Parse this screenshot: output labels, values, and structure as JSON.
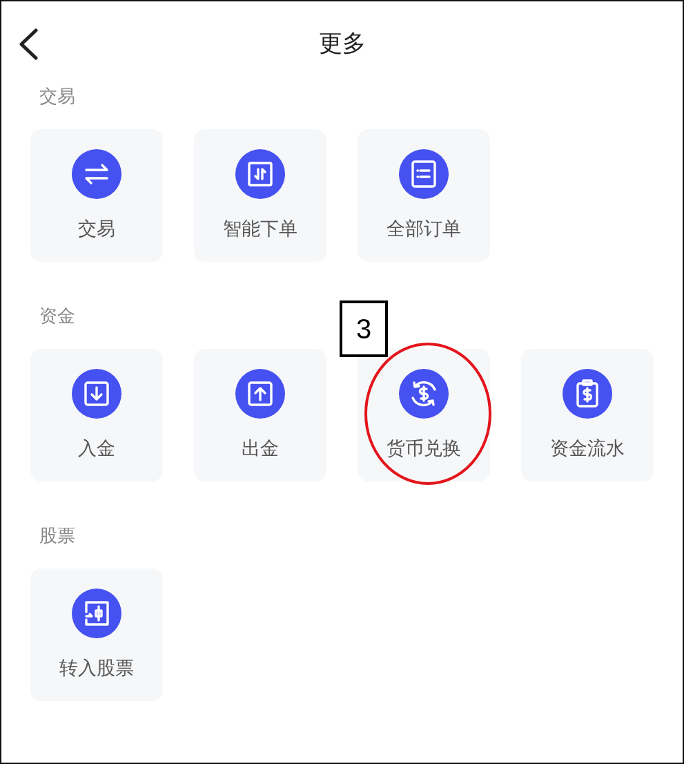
{
  "header": {
    "title": "更多"
  },
  "sections": [
    {
      "label": "交易",
      "items": [
        {
          "label": "交易",
          "kind": "swap",
          "circled": false
        },
        {
          "label": "智能下单",
          "kind": "updown",
          "circled": false
        },
        {
          "label": "全部订单",
          "kind": "list",
          "circled": false
        }
      ]
    },
    {
      "label": "资金",
      "items": [
        {
          "label": "入金",
          "kind": "deposit",
          "circled": false
        },
        {
          "label": "出金",
          "kind": "withdraw",
          "circled": false
        },
        {
          "label": "货币兑换",
          "kind": "exchange",
          "circled": true,
          "callout": "3"
        },
        {
          "label": "资金流水",
          "kind": "clipboard",
          "circled": false
        }
      ]
    },
    {
      "label": "股票",
      "items": [
        {
          "label": "转入股票",
          "kind": "transfer",
          "circled": false
        }
      ]
    }
  ]
}
